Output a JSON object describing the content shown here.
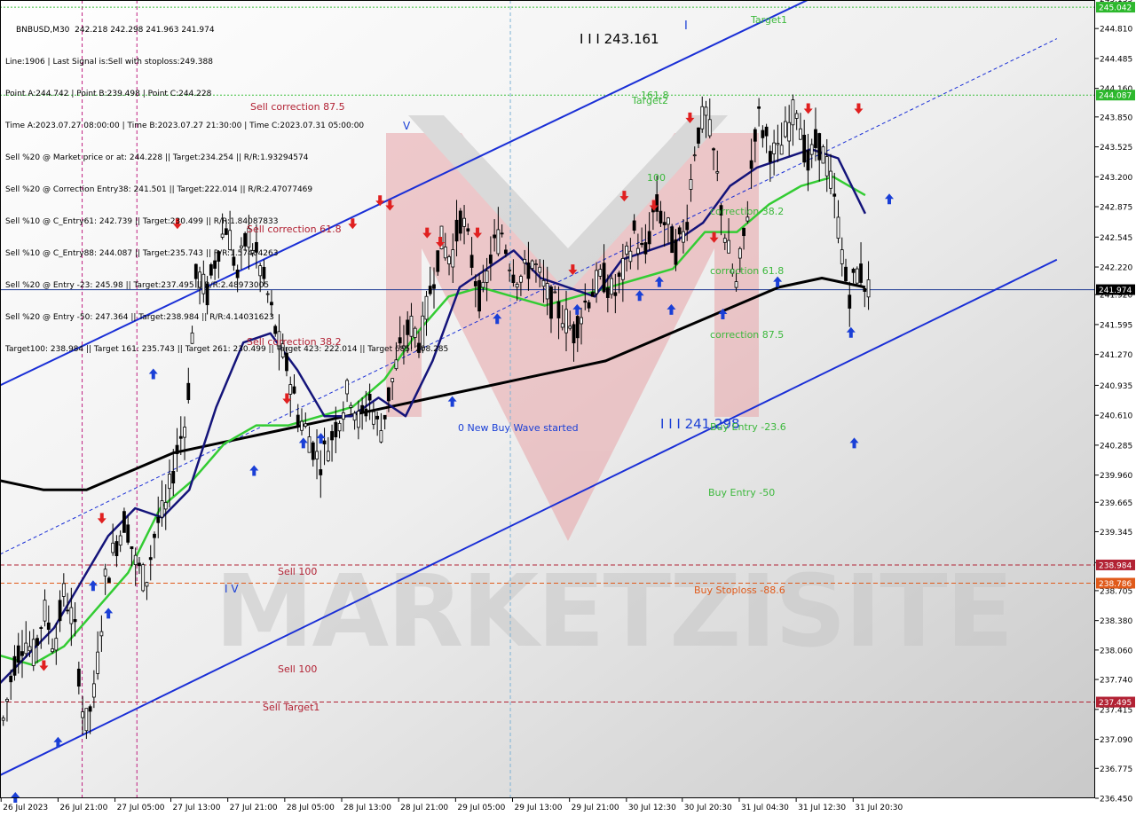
{
  "header": {
    "symbol_line": "BNBUSD,M30  242.218 242.298 241.963 241.974",
    "info_lines": [
      "Line:1906 | Last Signal is:Sell with stoploss:249.388",
      "Point A:244.742 | Point B:239.498 | Point C:244.228",
      "Time A:2023.07.27 08:00:00 | Time B:2023.07.27 21:30:00 | Time C:2023.07.31 05:00:00",
      "Sell %20 @ Market price or at: 244.228 || Target:234.254 || R/R:1.93294574",
      "Sell %20 @ Correction Entry38: 241.501 || Target:222.014 || R/R:2.47077469",
      "Sell %10 @ C_Entry61: 242.739 || Target:230.499 || R/R:1.84087833",
      "Sell %10 @ C_Entry88: 244.087 || Target:235.743 || R/R:1.57404263",
      "Sell %20 @ Entry -23: 245.98 || Target:237.495 || R/R:2.48973005",
      "Sell %20 @ Entry -50: 247.364 || Target:238.984 || R/R:4.14031623",
      "Target100: 238.984 || Target 161: 235.743 || Target 261: 230.499 || Target 423: 222.014 || Target 685: 208.285"
    ]
  },
  "chart_data": {
    "type": "candlestick",
    "symbol": "BNBUSD",
    "timeframe": "M30",
    "ylim": [
      236.45,
      245.12
    ],
    "y_ticks": [
      "245.135",
      "244.810",
      "244.485",
      "244.160",
      "243.850",
      "243.525",
      "243.200",
      "242.875",
      "242.545",
      "242.220",
      "241.920",
      "241.595",
      "241.270",
      "240.935",
      "240.610",
      "240.285",
      "239.960",
      "239.665",
      "239.345",
      "239.010",
      "238.705",
      "238.380",
      "238.060",
      "237.740",
      "237.415",
      "237.090",
      "236.775",
      "236.450"
    ],
    "x_ticks": [
      "26 Jul 2023",
      "26 Jul 21:00",
      "27 Jul 05:00",
      "27 Jul 13:00",
      "27 Jul 21:00",
      "28 Jul 05:00",
      "28 Jul 13:00",
      "28 Jul 21:00",
      "29 Jul 05:00",
      "29 Jul 13:00",
      "29 Jul 21:00",
      "30 Jul 12:30",
      "30 Jul 20:30",
      "31 Jul 04:30",
      "31 Jul 12:30",
      "31 Jul 20:30"
    ],
    "price_tags": [
      {
        "text": "245.042",
        "value": 245.042,
        "color": "#2db82d"
      },
      {
        "text": "244.087",
        "value": 244.087,
        "color": "#2db82d"
      },
      {
        "text": "241.974",
        "value": 241.974,
        "color": "#000000"
      },
      {
        "text": "238.984",
        "value": 238.984,
        "color": "#b22234"
      },
      {
        "text": "238.786",
        "value": 238.786,
        "color": "#e05a1a"
      },
      {
        "text": "237.495",
        "value": 237.495,
        "color": "#b22234"
      }
    ],
    "levels": [
      {
        "value": 245.042,
        "color": "#3cbf3c",
        "style": "dotted"
      },
      {
        "value": 244.087,
        "color": "#3cbf3c",
        "style": "dotted"
      },
      {
        "value": 241.974,
        "color": "#1f3a93",
        "style": "solid"
      },
      {
        "value": 238.984,
        "color": "#b22234",
        "style": "dashed"
      },
      {
        "value": 238.786,
        "color": "#e05a1a",
        "style": "dashed"
      },
      {
        "value": 237.495,
        "color": "#b22234",
        "style": "dashed"
      }
    ],
    "annotations": [
      {
        "text": "Target1",
        "color": "#3cb83c"
      },
      {
        "text": "I I I 243.161",
        "color": "#000000"
      },
      {
        "text": "I",
        "color": "#1a3fd6"
      },
      {
        "text": "161.8",
        "color": "#3cb83c"
      },
      {
        "text": "Target2",
        "color": "#3cb83c"
      },
      {
        "text": "Sell correction 87.5",
        "color": "#b22234"
      },
      {
        "text": "Sell correction 61.8",
        "color": "#b22234"
      },
      {
        "text": "Sell correction 38.2",
        "color": "#b22234"
      },
      {
        "text": "100",
        "color": "#3cb83c"
      },
      {
        "text": "correction 38.2",
        "color": "#3cb83c"
      },
      {
        "text": "correction 61.8",
        "color": "#3cb83c"
      },
      {
        "text": "correction 87.5",
        "color": "#3cb83c"
      },
      {
        "text": "0 New Buy Wave started",
        "color": "#1a3fd6"
      },
      {
        "text": "I I I 241.298",
        "color": "#1a3fd6"
      },
      {
        "text": "Buy Entry -23.6",
        "color": "#3cb83c"
      },
      {
        "text": "Buy Entry -50",
        "color": "#3cb83c"
      },
      {
        "text": "Sell 100",
        "color": "#b22234"
      },
      {
        "text": "Buy Stoploss -88.6",
        "color": "#e05a1a"
      },
      {
        "text": "I V",
        "color": "#1a3fd6"
      },
      {
        "text": "Sell 100",
        "color": "#b22234"
      },
      {
        "text": "Sell Target1",
        "color": "#b22234"
      },
      {
        "text": "V",
        "color": "#1a3fd6"
      }
    ],
    "watermark": "MARKETZISITE",
    "series": [
      {
        "name": "price",
        "kind": "candles",
        "path": [
          237.3,
          237.9,
          238.2,
          238.0,
          238.5,
          238.1,
          238.7,
          238.3,
          237.2,
          237.6,
          238.8,
          239.2,
          239.5,
          239.0,
          238.8,
          239.4,
          239.6,
          240.2,
          240.6,
          242.2,
          241.9,
          242.4,
          242.7,
          242.1,
          242.6,
          242.3,
          241.9,
          241.4,
          241.1,
          240.6,
          240.4,
          240.1,
          240.3,
          240.6,
          240.9,
          240.5,
          240.8,
          240.4,
          240.9,
          241.3,
          241.6,
          241.4,
          242.0,
          242.5,
          242.3,
          242.8,
          242.3,
          241.8,
          242.4,
          242.6,
          242.2,
          242.1,
          242.3,
          242.0,
          241.8,
          241.7,
          241.5,
          241.8,
          242.0,
          242.1,
          241.9,
          242.2,
          242.6,
          242.3,
          242.9,
          242.7,
          242.4,
          242.6,
          243.6,
          243.9,
          243.3,
          242.5,
          242.0,
          242.7,
          243.9,
          243.6,
          243.4,
          243.7,
          244.0,
          243.3,
          243.6,
          243.3,
          242.7,
          241.9,
          242.2,
          241.974
        ]
      }
    ],
    "ema_blue": [
      237.7,
      238.0,
      238.3,
      238.8,
      239.3,
      239.6,
      239.5,
      239.8,
      240.7,
      241.4,
      241.5,
      241.1,
      240.6,
      240.6,
      240.8,
      240.6,
      241.2,
      242.0,
      242.2,
      242.4,
      242.1,
      242.0,
      241.9,
      242.3,
      242.4,
      242.5,
      242.7,
      243.1,
      243.3,
      243.4,
      243.5,
      243.4,
      242.8
    ],
    "ema_green": [
      238.0,
      237.9,
      238.1,
      238.5,
      238.9,
      239.6,
      239.9,
      240.3,
      240.5,
      240.5,
      240.6,
      240.7,
      241.0,
      241.5,
      241.9,
      242.0,
      241.9,
      241.8,
      241.9,
      242.0,
      242.1,
      242.2,
      242.6,
      242.6,
      242.9,
      243.1,
      243.2,
      243.0
    ],
    "ema_black": [
      239.9,
      239.8,
      239.8,
      240.0,
      240.2,
      240.3,
      240.4,
      240.5,
      240.6,
      240.7,
      240.8,
      240.9,
      241.0,
      241.1,
      241.2,
      241.4,
      241.6,
      241.8,
      242.0,
      242.1,
      242.0
    ],
    "channel": {
      "upper": [
        [
          0.0,
          240.935
        ],
        [
          0.74,
          245.135
        ]
      ],
      "lower": [
        [
          0.0,
          236.7
        ],
        [
          0.965,
          242.3
        ]
      ],
      "middle": [
        [
          0.0,
          239.1
        ],
        [
          0.965,
          244.7
        ]
      ]
    }
  }
}
